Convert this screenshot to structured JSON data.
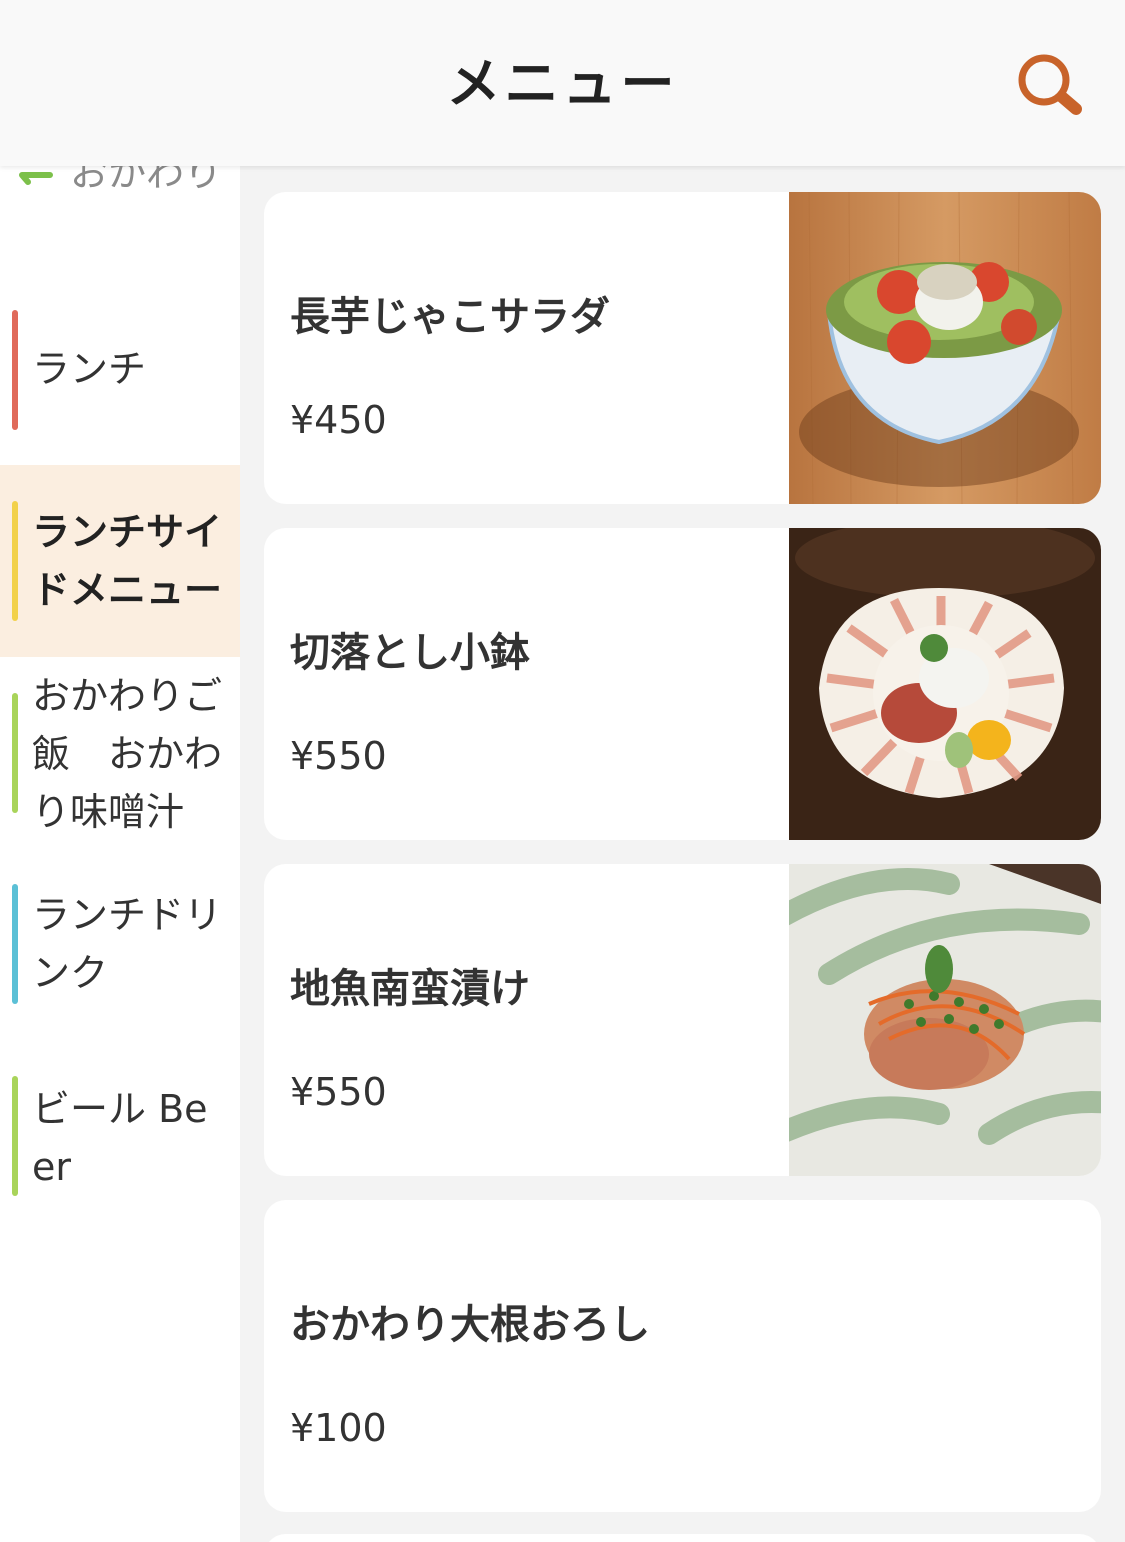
{
  "header": {
    "title": "メニュー",
    "search_icon": "search-icon",
    "accent_color": "#c8632a"
  },
  "sidebar": {
    "peek_label": "おかわり",
    "peek_icon": "refresh-icon",
    "categories": [
      {
        "label": "ランチ",
        "color": "#e06a5a",
        "active": false
      },
      {
        "label": "ランチサイドメニュー",
        "color": "#f2d14a",
        "active": true
      },
      {
        "label": "おかわりご飯　おかわり味噌汁",
        "color": "#a9d45a",
        "active": false
      },
      {
        "label": "ランチドリンク",
        "color": "#5bc0d6",
        "active": false
      },
      {
        "label": "ビール Beer",
        "color": "#a9d45a",
        "active": false
      }
    ]
  },
  "menu_items": [
    {
      "name": "長芋じゃこサラダ",
      "price": "¥450",
      "photo": "salad-photo"
    },
    {
      "name": "切落とし小鉢",
      "price": "¥550",
      "photo": "sashimi-bowl-photo"
    },
    {
      "name": "地魚南蛮漬け",
      "price": "¥550",
      "photo": "nanban-photo"
    },
    {
      "name": "おかわり大根おろし",
      "price": "¥100",
      "photo": null
    }
  ]
}
